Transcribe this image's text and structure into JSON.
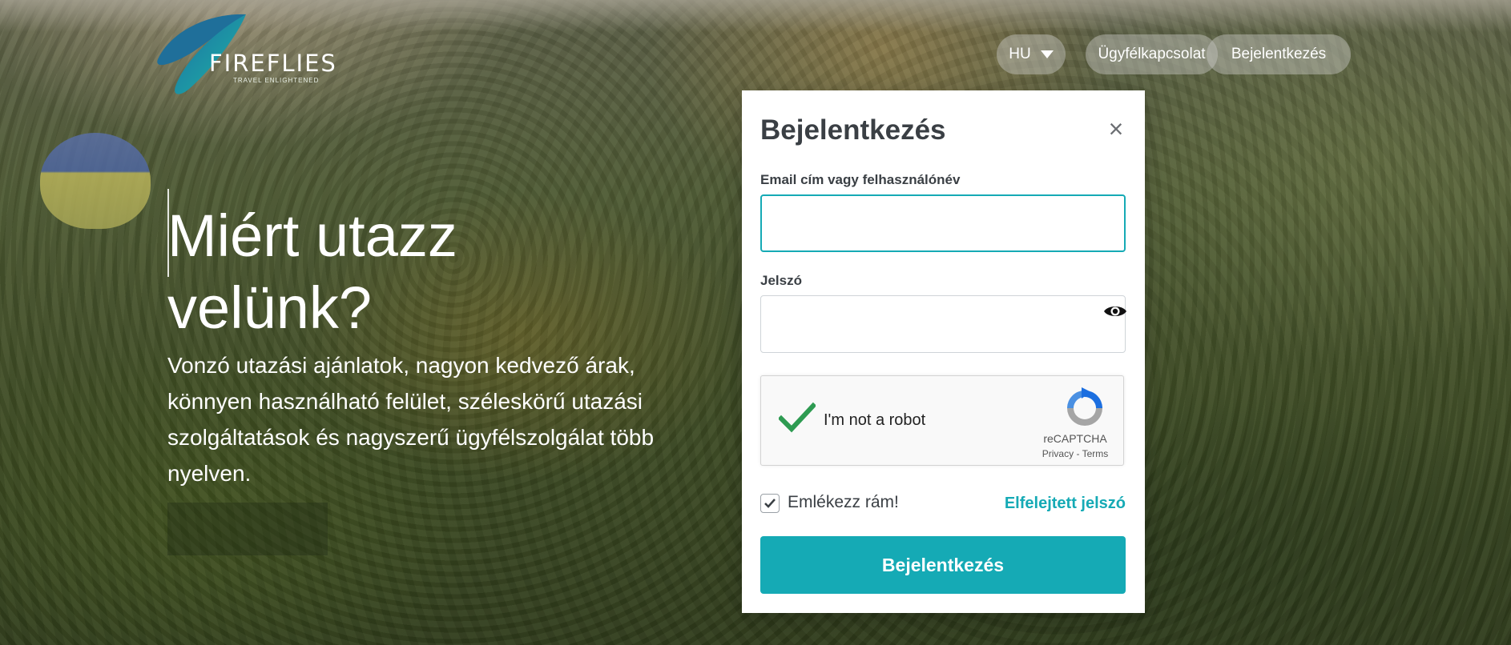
{
  "brand": {
    "name": "FIREFLIES",
    "tagline": "TRAVEL ENLIGHTENED"
  },
  "nav": {
    "language": "HU",
    "contact": "Ügyfélkapcsolat",
    "login": "Bejelentkezés"
  },
  "hero": {
    "title": "Miért utazz velünk?",
    "subtitle": "Vonzó utazási ajánlatok, nagyon kedvező árak, könnyen használható felület, széleskörű utazási szolgáltatások és nagyszerű ügyfélszolgálat több nyelven."
  },
  "login_modal": {
    "title": "Bejelentkezés",
    "email_label": "Email cím vagy felhasználónév",
    "email_value": "",
    "password_label": "Jelszó",
    "password_value": "",
    "recaptcha": {
      "text": "I'm not a robot",
      "brand": "reCAPTCHA",
      "privacy": "Privacy",
      "separator": "-",
      "terms": "Terms"
    },
    "remember_label": "Emlékezz rám!",
    "forgot_link": "Elfelejtett jelszó",
    "submit_label": "Bejelentkezés"
  },
  "colors": {
    "accent": "#15aab5",
    "title_text": "#3a3f44",
    "check_green": "#2e9b52"
  }
}
